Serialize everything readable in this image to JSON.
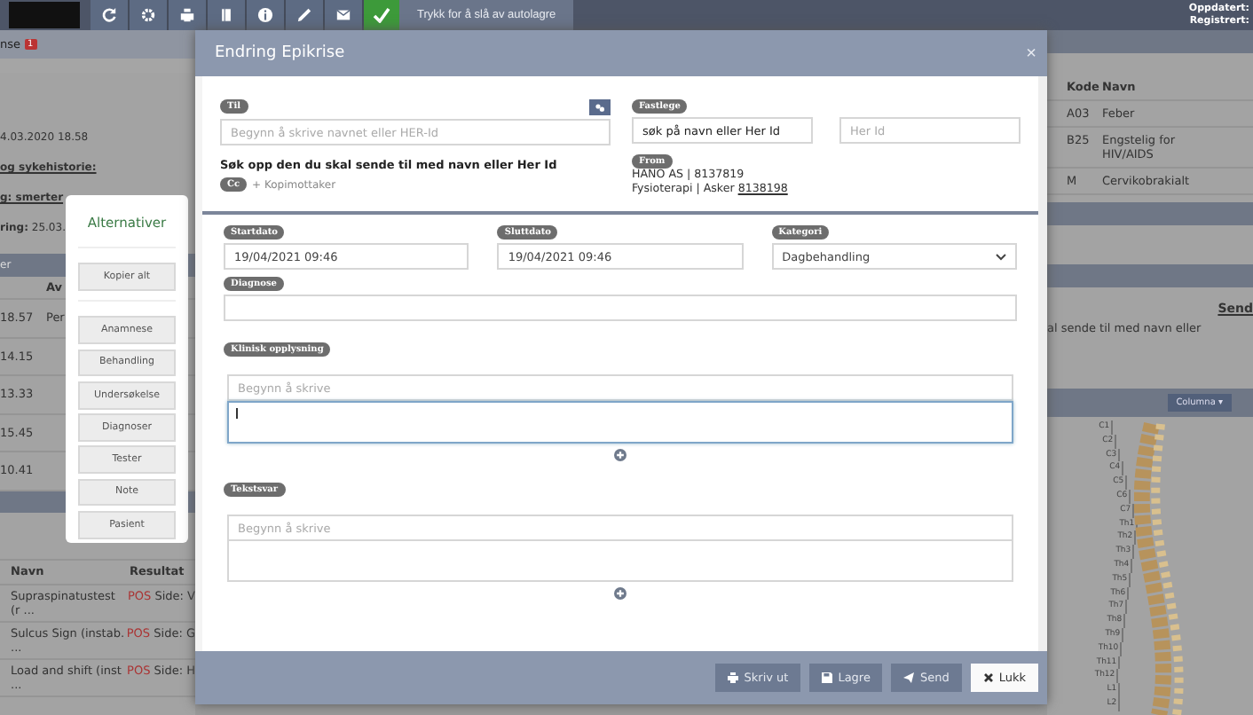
{
  "toolbar": {
    "autosave": {
      "label": "Trykk for å slå av autolagre",
      "on": true
    },
    "meta": [
      "Oppdatert:",
      "Registrert:"
    ]
  },
  "left": {
    "tab": {
      "label": "nse",
      "badge": "1"
    },
    "notes": [
      {
        "text": "4.03.2020 18.58",
        "kind": "plain"
      },
      {
        "text": "og sykehistorie:",
        "kind": "heading"
      },
      {
        "text": "g: smerter",
        "kind": "heading"
      },
      {
        "text": "**ring:** 25.03.",
        "kind": "plain"
      }
    ],
    "panel_title": "er",
    "log_header": "Av",
    "log_rows": [
      {
        "time": "18.57",
        "by": "Per"
      },
      {
        "time": "14.15"
      },
      {
        "time": "13.33"
      },
      {
        "time": "15.45"
      },
      {
        "time": "10.41"
      }
    ],
    "tests": {
      "columns": [
        "Navn",
        "Resultat"
      ],
      "rows": [
        {
          "name": "Supraspinatustest (r ...",
          "result": "POS",
          "side": "Side: V"
        },
        {
          "name": "Sulcus Sign (instab. ...",
          "result": "POS",
          "side": "Side: G"
        },
        {
          "name": "Load and shift (inst ...",
          "result": "POS",
          "side": "Side: H"
        }
      ]
    }
  },
  "right": {
    "columns": [
      "Kode",
      "Navn"
    ],
    "rows": [
      {
        "code": "A03",
        "name": "Feber"
      },
      {
        "code": "B25",
        "name": "Engstelig for HIV/AIDS"
      },
      {
        "code": "M",
        "name": "Cervikobrakialt"
      }
    ],
    "send_header": "Send",
    "send_hint": "al sende til med navn eller",
    "columna_button": "Columna ▾",
    "spine_labels": [
      "C1",
      "C2",
      "C3",
      "C4",
      "C5",
      "C6",
      "C7",
      "Th1",
      "Th2",
      "Th3",
      "Th4",
      "Th5",
      "Th6",
      "Th7",
      "Th8",
      "Th9",
      "Th10",
      "Th11",
      "Th12",
      "L1",
      "L2"
    ]
  },
  "alternatives": {
    "title": "Alternativer",
    "copy_all": "Kopier alt",
    "items": [
      "Anamnese",
      "Behandling",
      "Undersøkelse",
      "Diagnoser",
      "Tester",
      "Note",
      "Pasient"
    ]
  },
  "modal": {
    "title": "Endring Epikrise",
    "close": "×",
    "til": {
      "label": "Til",
      "placeholder": "Begynn å skrive navnet eller HER-Id",
      "hint": "Søk opp den du skal sende til med navn eller Her Id",
      "cc": "Cc",
      "cc_link": "+ Kopimottaker"
    },
    "fastlege": {
      "label": "Fastlege",
      "value": "søk på navn eller Her Id",
      "herid_placeholder": "Her Id"
    },
    "from": {
      "label": "From",
      "line_1": "HANO AS | 8137819",
      "line_2": "Fysioterapi | Asker",
      "link": "8138198"
    },
    "fields": [
      {
        "label": "Startdato",
        "value": "19/04/2021 09:46",
        "kind": "input"
      },
      {
        "label": "Sluttdato",
        "value": "19/04/2021 09:46",
        "kind": "input"
      },
      {
        "label": "Kategori",
        "value": "Dagbehandling",
        "kind": "select"
      }
    ],
    "diagnose": {
      "label": "Diagnose"
    },
    "sections": [
      {
        "label": "Klinisk opplysning",
        "placeholder": "Begynn å skrive",
        "focused": true
      },
      {
        "label": "Tekstsvar",
        "placeholder": "Begynn å skrive",
        "focused": false
      }
    ],
    "buttons": [
      {
        "label": "Skriv ut",
        "kind": "print"
      },
      {
        "label": "Lagre",
        "kind": "save"
      },
      {
        "label": "Send",
        "kind": "send"
      },
      {
        "label": "Lukk",
        "kind": "close"
      }
    ]
  }
}
